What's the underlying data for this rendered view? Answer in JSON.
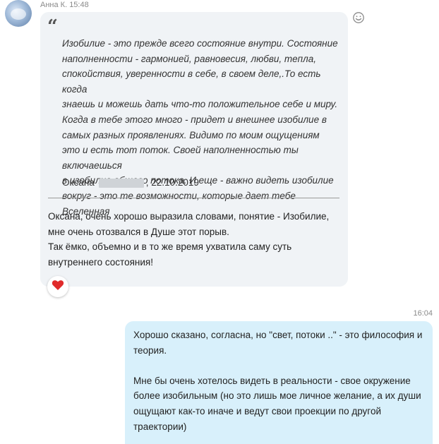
{
  "incoming": {
    "sender": "Анна К.",
    "time": "15:48",
    "quote": {
      "lines": [
        "Изобилие - это прежде всего состояние внутри. Состояние",
        "наполненности -  гармонией, равновесия, любви, тепла,",
        "спокойствия, уверенности в себе, в своем деле,.То есть когда",
        "знаешь и можешь дать что-то положительное себе и миру.",
        "Когда в тебе этого много - придет и внешнее изобилие в",
        "самых разных проявлениях. Видимо по моим ощущениям",
        "это и есть тот поток. Своей наполненностью ты включаешься",
        "в изобилие общего потока. И еще - важно видеть изобилие",
        "вокруг - это те возможности, которые дает тебе Вселенная"
      ],
      "author_name": "Оксана",
      "date": ", 22.10.2019"
    },
    "reply_lines": [
      "Оксана, очень хорошо выразила словами, понятие - Изобилие,",
      "мне очень отозвался в Душе этот порыв.",
      "Так ёмко, объемно и в то же время ухватила саму суть",
      "внутреннего состояния!"
    ],
    "reaction_icon": "heart-icon",
    "reaction_color": "#e02b2b"
  },
  "outgoing": {
    "time": "16:04",
    "paragraph1": [
      "Хорошо сказано, согласна, но \"свет, потоки ..\" - это философия и",
      "теория."
    ],
    "paragraph2": [
      "Мне бы очень хотелось видеть в реальности - свое окружение",
      "более изобильным (но это лишь мое личное желание, а их души",
      "ощущают как-то иначе и ведут свои проекции по другой",
      "траектории)"
    ]
  },
  "colors": {
    "incoming_bubble": "#f0f3f6",
    "outgoing_bubble": "#d8f0fb",
    "meta_text": "#8a8a8a"
  }
}
